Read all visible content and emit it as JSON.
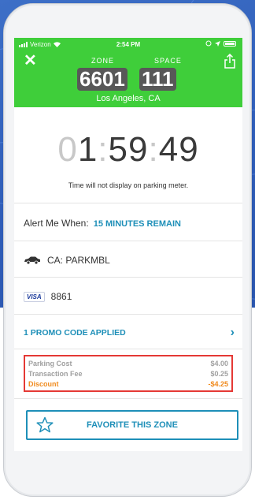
{
  "status_bar": {
    "carrier": "Verizon",
    "time": "2:54 PM"
  },
  "header": {
    "close_icon": "close-icon",
    "share_icon": "share-icon",
    "zone_label": "ZONE",
    "space_label": "SPACE",
    "zone_number": "6601",
    "space_number": "111",
    "city": "Los Angeles, CA",
    "background_color": "#3fce3a"
  },
  "timer": {
    "leading_digit": "0",
    "hours_rest": "1",
    "colon1": ":",
    "minutes": "59",
    "colon2": ":",
    "seconds": "49",
    "note": "Time will not display on parking meter."
  },
  "alert": {
    "label": "Alert Me When:",
    "value": "15 MINUTES REMAIN"
  },
  "vehicle": {
    "icon": "car-icon",
    "plate": "CA: PARKMBL"
  },
  "payment": {
    "card_brand": "VISA",
    "last_four": "8861"
  },
  "promo": {
    "label": "1 PROMO CODE APPLIED",
    "chevron": "›"
  },
  "summary": {
    "items": [
      {
        "label": "Parking Cost",
        "amount": "$4.00"
      },
      {
        "label": "Transaction Fee",
        "amount": "$0.25"
      },
      {
        "label": "Discount",
        "amount": "-$4.25"
      }
    ]
  },
  "favorite": {
    "icon": "star-icon",
    "label": "FAVORITE THIS ZONE"
  },
  "colors": {
    "accent": "#1e8fb8",
    "highlight_border": "#e53935",
    "discount": "#f08a1c"
  }
}
